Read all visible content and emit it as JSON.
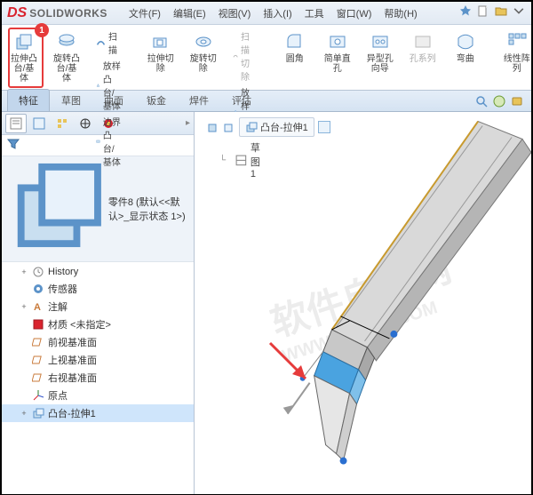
{
  "app": {
    "name": "SOLIDWORKS",
    "logo_prefix": "DS"
  },
  "menu": [
    "文件(F)",
    "编辑(E)",
    "视图(V)",
    "插入(I)",
    "工具",
    "窗口(W)",
    "帮助(H)"
  ],
  "ribbon": {
    "extrude": "拉伸凸台/基体",
    "revolve": "旋转凸台/基体",
    "sweep": "扫描",
    "loft": "放样凸台/基体",
    "boundary": "边界凸台/基体",
    "extrude_cut": "拉伸切除",
    "revolve_cut": "旋转切除",
    "sweep_cut": "扫描切除",
    "loft_cut": "放样切割",
    "boundary_cut": "放样切割",
    "fillet": "圆角",
    "hole_simple": "简单直孔",
    "hole_wizard": "异型孔向导",
    "hole_series": "孔系列",
    "wrap": "弯曲",
    "linear_pattern": "线性阵列"
  },
  "tabs": [
    "特征",
    "草图",
    "曲面",
    "钣金",
    "焊件",
    "评估"
  ],
  "active_tab": 0,
  "tree": {
    "part_name": "零件8 (默认<<默认>_显示状态 1>)",
    "nodes": [
      {
        "icon": "history",
        "label": "History",
        "expand": "+"
      },
      {
        "icon": "sensor",
        "label": "传感器"
      },
      {
        "icon": "annot",
        "label": "注解",
        "expand": "+"
      },
      {
        "icon": "material",
        "label": "材质 <未指定>"
      },
      {
        "icon": "plane",
        "label": "前视基准面"
      },
      {
        "icon": "plane",
        "label": "上视基准面"
      },
      {
        "icon": "plane",
        "label": "右视基准面"
      },
      {
        "icon": "origin",
        "label": "原点"
      },
      {
        "icon": "extrude",
        "label": "凸台-拉伸1",
        "expand": "+",
        "selected": true
      }
    ]
  },
  "breadcrumb": {
    "feature": "凸台-拉伸1",
    "sketch": "草图1"
  },
  "annotation": {
    "badge": "1"
  },
  "watermark": {
    "line1": "软件自学网",
    "line2": "WWW.RJZXW.COM"
  }
}
